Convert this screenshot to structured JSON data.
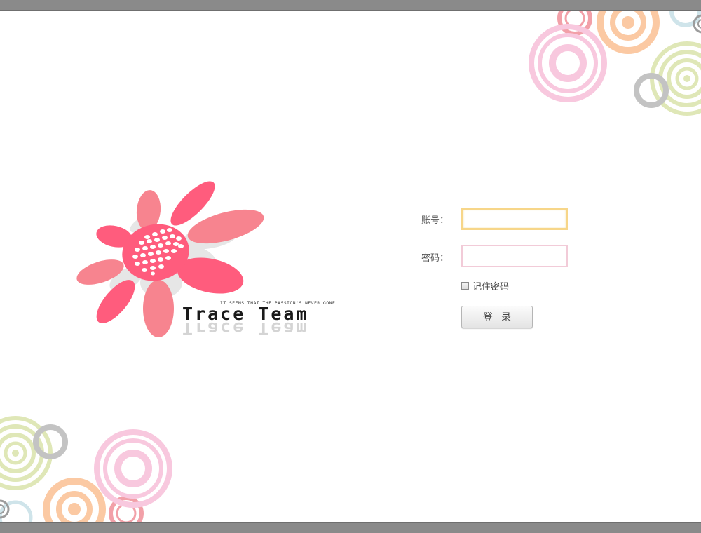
{
  "login": {
    "account_label": "账号：",
    "account_value": "",
    "password_label": "密码：",
    "password_value": "",
    "remember_label": "记住密码",
    "submit_label": "登录"
  },
  "logo": {
    "tagline": "IT SEEMS THAT THE PASSION'S NEVER GONE",
    "brand": "Trace Team"
  },
  "colors": {
    "top_bar": "#8a8a8a",
    "petal_primary": "#ff5c7d",
    "petal_secondary": "#f7848f",
    "ring_pink": "#f8c8de",
    "ring_orange": "#fbc9a3",
    "ring_green": "#dfe7b7",
    "ring_gray": "#c3c3c3",
    "ring_blue": "#cfe4ea",
    "input_focus_border": "#f7d689"
  }
}
